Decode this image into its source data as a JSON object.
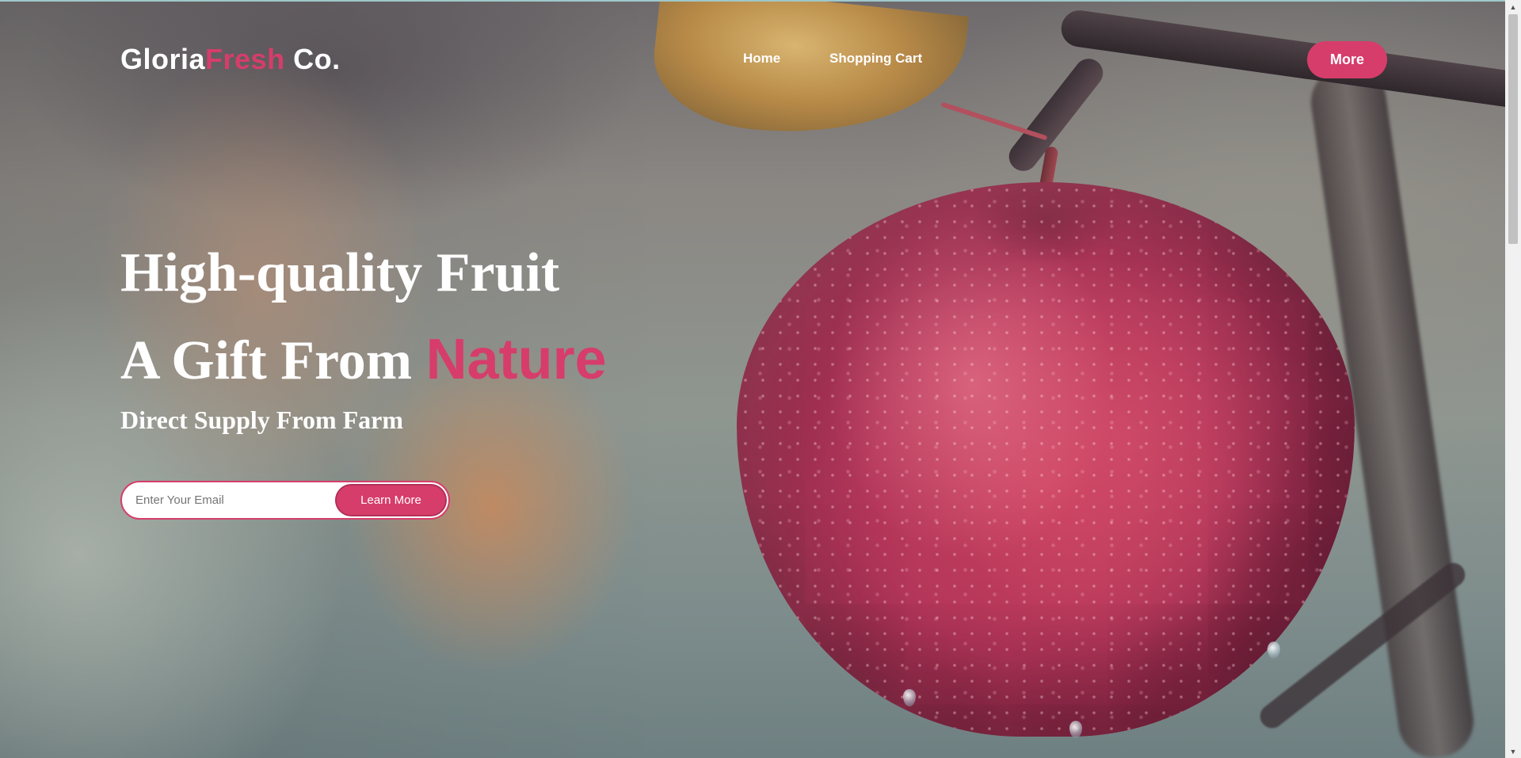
{
  "brand": {
    "part1": "Gloria",
    "part2": "Fresh",
    "part3": " Co.",
    "accent_color": "#d63d6b"
  },
  "nav": {
    "home_label": "Home",
    "cart_label": "Shopping Cart",
    "more_label": "More"
  },
  "hero": {
    "headline_line1": "High-quality Fruit",
    "headline_line2_prefix": "A Gift From ",
    "headline_line2_accent": "Nature",
    "subheadline": "Direct Supply From Farm",
    "background_image": "red-apple-on-branch"
  },
  "signup": {
    "email_placeholder": "Enter Your Email",
    "email_value": "",
    "button_label": "Learn More"
  },
  "icons": {
    "scroll_up": "scroll-up-arrow-icon",
    "scroll_down": "scroll-down-arrow-icon"
  }
}
